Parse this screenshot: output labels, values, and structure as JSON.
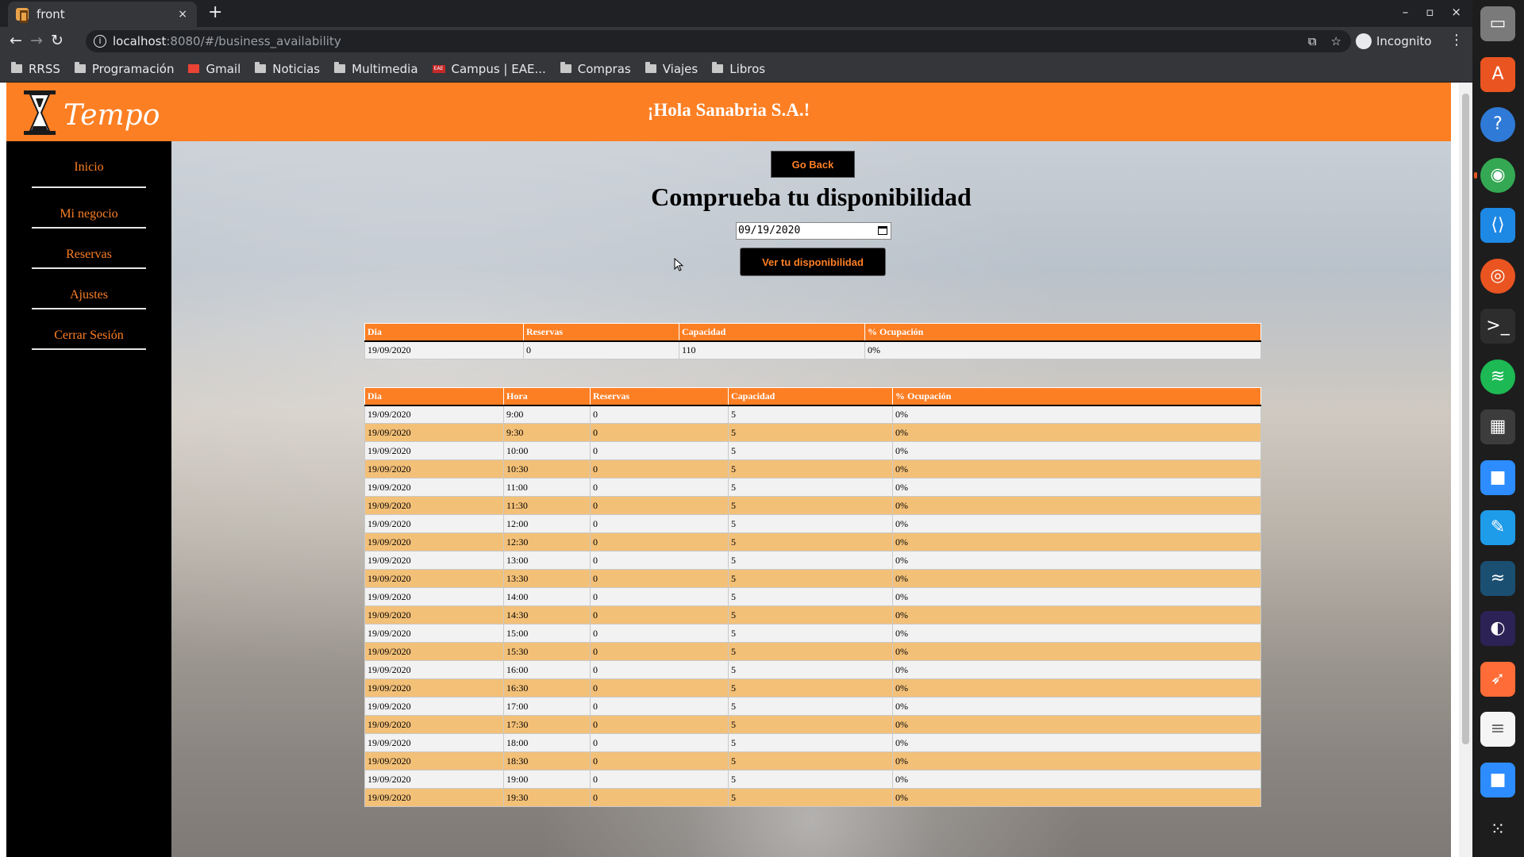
{
  "browser": {
    "tab_title": "front",
    "tab_close": "×",
    "new_tab": "+",
    "url_host": "localhost",
    "url_rest": ":8080/#/business_availability",
    "incognito_label": "Incognito",
    "window_controls": [
      "–",
      "▫",
      "×"
    ],
    "bookmarks": [
      {
        "label": "RRSS",
        "icon": "folder-icon"
      },
      {
        "label": "Programación",
        "icon": "folder-icon"
      },
      {
        "label": "Gmail",
        "icon": "gmail-icon"
      },
      {
        "label": "Noticias",
        "icon": "folder-icon"
      },
      {
        "label": "Multimedia",
        "icon": "folder-icon"
      },
      {
        "label": "Campus | EAE...",
        "icon": "eae-icon"
      },
      {
        "label": "Compras",
        "icon": "folder-icon"
      },
      {
        "label": "Viajes",
        "icon": "folder-icon"
      },
      {
        "label": "Libros",
        "icon": "folder-icon"
      }
    ]
  },
  "header": {
    "logo_text": "Tempo",
    "greeting": "¡Hola Sanabria S.A.!"
  },
  "sidebar": {
    "items": [
      {
        "label": "Inicio"
      },
      {
        "label": "Mi negocio"
      },
      {
        "label": "Reservas"
      },
      {
        "label": "Ajustes"
      },
      {
        "label": "Cerrar Sesión"
      }
    ]
  },
  "main": {
    "go_back_label": "Go Back",
    "title": "Comprueba tu disponibilidad",
    "date_value": "09/19/2020",
    "check_button_label": "Ver tu disponibilidad"
  },
  "summary_table": {
    "headers": [
      "Dia",
      "Reservas",
      "Capacidad",
      "% Ocupación"
    ],
    "rows": [
      [
        "19/09/2020",
        "0",
        "110",
        "0%"
      ]
    ]
  },
  "slots_table": {
    "headers": [
      "Dia",
      "Hora",
      "Reservas",
      "Capacidad",
      "% Ocupación"
    ],
    "rows": [
      [
        "19/09/2020",
        "9:00",
        "0",
        "5",
        "0%"
      ],
      [
        "19/09/2020",
        "9:30",
        "0",
        "5",
        "0%"
      ],
      [
        "19/09/2020",
        "10:00",
        "0",
        "5",
        "0%"
      ],
      [
        "19/09/2020",
        "10:30",
        "0",
        "5",
        "0%"
      ],
      [
        "19/09/2020",
        "11:00",
        "0",
        "5",
        "0%"
      ],
      [
        "19/09/2020",
        "11:30",
        "0",
        "5",
        "0%"
      ],
      [
        "19/09/2020",
        "12:00",
        "0",
        "5",
        "0%"
      ],
      [
        "19/09/2020",
        "12:30",
        "0",
        "5",
        "0%"
      ],
      [
        "19/09/2020",
        "13:00",
        "0",
        "5",
        "0%"
      ],
      [
        "19/09/2020",
        "13:30",
        "0",
        "5",
        "0%"
      ],
      [
        "19/09/2020",
        "14:00",
        "0",
        "5",
        "0%"
      ],
      [
        "19/09/2020",
        "14:30",
        "0",
        "5",
        "0%"
      ],
      [
        "19/09/2020",
        "15:00",
        "0",
        "5",
        "0%"
      ],
      [
        "19/09/2020",
        "15:30",
        "0",
        "5",
        "0%"
      ],
      [
        "19/09/2020",
        "16:00",
        "0",
        "5",
        "0%"
      ],
      [
        "19/09/2020",
        "16:30",
        "0",
        "5",
        "0%"
      ],
      [
        "19/09/2020",
        "17:00",
        "0",
        "5",
        "0%"
      ],
      [
        "19/09/2020",
        "17:30",
        "0",
        "5",
        "0%"
      ],
      [
        "19/09/2020",
        "18:00",
        "0",
        "5",
        "0%"
      ],
      [
        "19/09/2020",
        "18:30",
        "0",
        "5",
        "0%"
      ],
      [
        "19/09/2020",
        "19:00",
        "0",
        "5",
        "0%"
      ],
      [
        "19/09/2020",
        "19:30",
        "0",
        "5",
        "0%"
      ]
    ]
  },
  "colors": {
    "brand_orange": "#fd7f24",
    "row_alt": "#f3c078",
    "sidebar_bg": "#000000"
  },
  "dock": {
    "items": [
      {
        "name": "files-icon",
        "color": "#7a7a7a"
      },
      {
        "name": "software-center-icon",
        "color": "#e95420"
      },
      {
        "name": "help-icon",
        "color": "#2f7ad6"
      },
      {
        "name": "chrome-icon",
        "color": "#34a853"
      },
      {
        "name": "vscode-icon",
        "color": "#1e88e5"
      },
      {
        "name": "ubuntu-icon",
        "color": "#e95420"
      },
      {
        "name": "terminal-icon",
        "color": "#2d2d2d"
      },
      {
        "name": "spotify-icon",
        "color": "#1db954"
      },
      {
        "name": "calculator-icon",
        "color": "#3c3c3c"
      },
      {
        "name": "zoom-icon",
        "color": "#2d8cff"
      },
      {
        "name": "notes-app-icon",
        "color": "#1e9be9"
      },
      {
        "name": "mysql-workbench-icon",
        "color": "#1b4f72"
      },
      {
        "name": "eclipse-icon",
        "color": "#2c2255"
      },
      {
        "name": "postman-icon",
        "color": "#ff6c37"
      },
      {
        "name": "text-editor-icon",
        "color": "#f5f5f5"
      },
      {
        "name": "zoom-meetings-icon",
        "color": "#2d8cff"
      },
      {
        "name": "show-apps-icon",
        "color": "#1d1d1d"
      }
    ]
  }
}
